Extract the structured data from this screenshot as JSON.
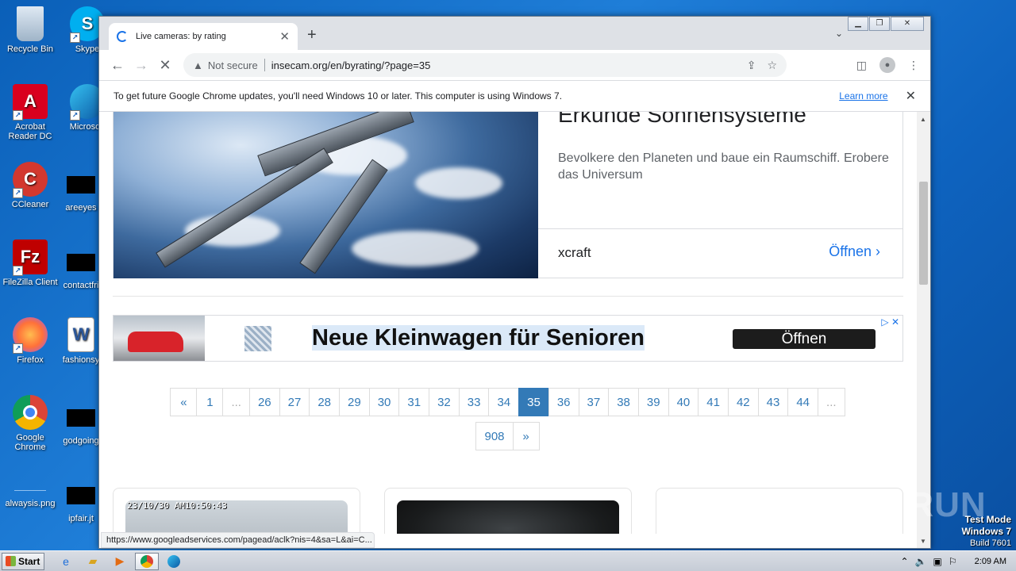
{
  "desktop": {
    "icons": [
      {
        "label": "Recycle Bin",
        "icon": "recycle-bin-icon"
      },
      {
        "label": "Skype",
        "icon": "skype-icon"
      },
      {
        "label": "Acrobat Reader DC",
        "icon": "acrobat-icon"
      },
      {
        "label": "Microsoft",
        "icon": "edge-icon"
      },
      {
        "label": "CCleaner",
        "icon": "ccleaner-icon"
      },
      {
        "label": "areeyes",
        "icon": "black-file-icon"
      },
      {
        "label": "FileZilla Client",
        "icon": "filezilla-icon"
      },
      {
        "label": "contactfri",
        "icon": "black-file-icon"
      },
      {
        "label": "Firefox",
        "icon": "firefox-icon"
      },
      {
        "label": "fashionsy",
        "icon": "word-icon"
      },
      {
        "label": "Google Chrome",
        "icon": "chrome-icon"
      },
      {
        "label": "godgoing",
        "icon": "black-file-icon"
      },
      {
        "label": "alwaysis.png",
        "icon": "image-file-icon"
      },
      {
        "label": "ipfair.jt",
        "icon": "black-file-icon"
      }
    ]
  },
  "browser": {
    "tab_title": "Live cameras: by rating",
    "not_secure": "Not secure",
    "url": "insecam.org/en/byrating/?page=35",
    "infobar_message": "To get future Google Chrome updates, you'll need Windows 10 or later. This computer is using Windows 7.",
    "infobar_link": "Learn more",
    "status_url": "https://www.googleadservices.com/pagead/aclk?nis=4&sa=L&ai=C..."
  },
  "page": {
    "ad1": {
      "headline": "Erkunde Sonnensysteme",
      "description": "Bevolkere den Planeten und baue ein Raumschiff. Erobere das Universum",
      "brand": "xcraft",
      "open_label": "Öffnen"
    },
    "ad2": {
      "text": "Neue Kleinwagen für Senioren",
      "button": "Öffnen"
    },
    "pagination": {
      "row1": [
        "«",
        "1",
        "...",
        "26",
        "27",
        "28",
        "29",
        "30",
        "31",
        "32",
        "33",
        "34",
        "35",
        "36",
        "37",
        "38",
        "39",
        "40",
        "41",
        "42",
        "43",
        "44",
        "..."
      ],
      "row2": [
        "908",
        "»"
      ],
      "current": "35"
    },
    "cameras": [
      {
        "timestamp": "23/10/30 AM10:50:43",
        "style": "sky"
      },
      {
        "timestamp": "",
        "style": "dark"
      },
      {
        "timestamp": "",
        "style": "blank"
      }
    ]
  },
  "overlay": {
    "watermark": "ANY RUN",
    "test_mode": "Test Mode",
    "os": "Windows 7",
    "build": "Build 7601"
  },
  "taskbar": {
    "start": "Start",
    "clock": "2:09 AM"
  }
}
